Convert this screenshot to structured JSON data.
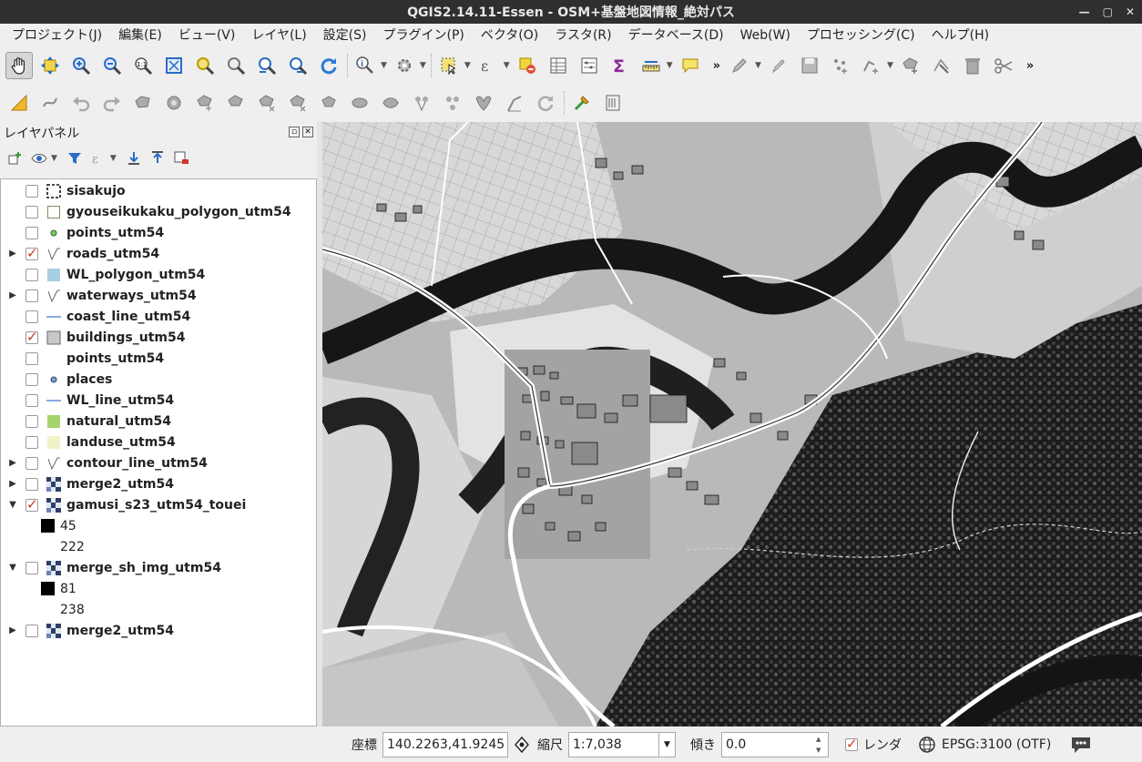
{
  "window": {
    "title": "QGIS2.14.11-Essen - OSM+基盤地図情報_絶対パス",
    "min": "—",
    "max": "▢",
    "close": "✕"
  },
  "menu": [
    "プロジェクト(J)",
    "編集(E)",
    "ビュー(V)",
    "レイヤ(L)",
    "設定(S)",
    "プラグイン(P)",
    "ベクタ(O)",
    "ラスタ(R)",
    "データベース(D)",
    "Web(W)",
    "プロセッシング(C)",
    "ヘルプ(H)"
  ],
  "layers_panel": {
    "title": "レイヤパネル",
    "layers": [
      {
        "name": "sisakujo",
        "checked": false,
        "expand": "",
        "symbol": "dashed-frame-icon"
      },
      {
        "name": "gyouseikukaku_polygon_utm54",
        "checked": false,
        "expand": "",
        "symbol": "polygon-outline-icon"
      },
      {
        "name": "points_utm54",
        "checked": false,
        "expand": "",
        "symbol": "green-point-icon"
      },
      {
        "name": "roads_utm54",
        "checked": true,
        "expand": "▶",
        "symbol": "rule-line-icon"
      },
      {
        "name": "WL_polygon_utm54",
        "checked": false,
        "expand": "",
        "symbol": "blue-fill-icon"
      },
      {
        "name": "waterways_utm54",
        "checked": false,
        "expand": "▶",
        "symbol": "rule-line-icon"
      },
      {
        "name": "coast_line_utm54",
        "checked": false,
        "expand": "",
        "symbol": "blue-line-icon"
      },
      {
        "name": "buildings_utm54",
        "checked": true,
        "expand": "",
        "symbol": "gray-fill-icon"
      },
      {
        "name": "points_utm54",
        "checked": false,
        "expand": "",
        "symbol": "none"
      },
      {
        "name": "places",
        "checked": false,
        "expand": "",
        "symbol": "blue-point-icon"
      },
      {
        "name": "WL_line_utm54",
        "checked": false,
        "expand": "",
        "symbol": "blue-line-icon"
      },
      {
        "name": "natural_utm54",
        "checked": false,
        "expand": "",
        "symbol": "green-fill-icon"
      },
      {
        "name": "landuse_utm54",
        "checked": false,
        "expand": "",
        "symbol": "cream-fill-icon"
      },
      {
        "name": "contour_line_utm54",
        "checked": false,
        "expand": "▶",
        "symbol": "rule-line-icon"
      },
      {
        "name": "merge2_utm54",
        "checked": false,
        "expand": "▶",
        "symbol": "raster-icon"
      },
      {
        "name": "gamusi_s23_utm54_touei",
        "checked": true,
        "expand": "▼",
        "symbol": "raster-icon"
      },
      {
        "name": "merge_sh_img_utm54",
        "checked": false,
        "expand": "▼",
        "symbol": "raster-icon"
      },
      {
        "name": "merge2_utm54",
        "checked": false,
        "expand": "▶",
        "symbol": "raster-icon"
      }
    ],
    "legend": {
      "gamusi_min": "45",
      "gamusi_max": "222",
      "merge_sh_min": "81",
      "merge_sh_max": "238"
    }
  },
  "status": {
    "coord_label": "座標",
    "coord_value": "140.2263,41.9245",
    "scale_label": "縮尺",
    "scale_value": "1:7,038",
    "rotation_label": "傾き",
    "rotation_value": "0.0",
    "render_label": "レンダ",
    "render_checked": true,
    "crs": "EPSG:3100 (OTF)"
  }
}
